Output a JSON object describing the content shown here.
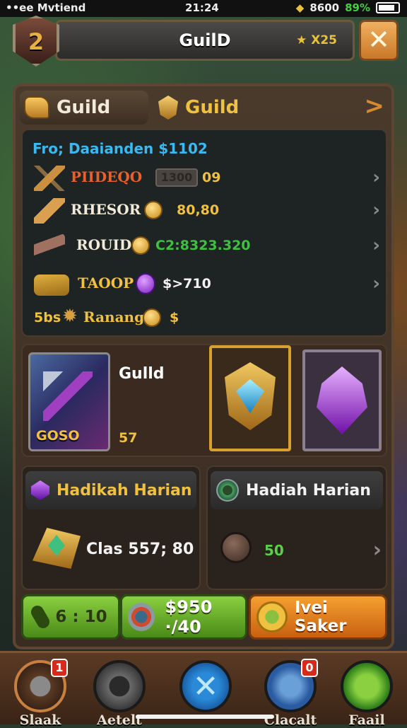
{
  "status_bar": {
    "carrier": "••ee Mvtiend",
    "time": "21:24",
    "coins": "8600",
    "battery": "89%"
  },
  "header": {
    "level": "2",
    "title": "GuilD",
    "currency": "X25",
    "close_label": "✕"
  },
  "tabs": [
    {
      "label": "Guild"
    },
    {
      "label": "Guild"
    }
  ],
  "tab_arrow": ">",
  "list": {
    "heading": "Fro; Daaianden $1102",
    "rows": [
      {
        "label": "PIIDEQO",
        "pill": "1300",
        "value": "09",
        "label_color": "#e8602a",
        "value_color": "#f0c040"
      },
      {
        "label": "RHESOR",
        "value": "80,80",
        "label_color": "#f2ead8",
        "value_color": "#f0c040"
      },
      {
        "label": "ROUID",
        "value": "C2:8323.320",
        "label_color": "#f2ead8",
        "value_color": "#40c040"
      },
      {
        "label": "TAOOP",
        "value": "$>710",
        "label_color": "#f0c040",
        "value_color": "#f2f2f2"
      },
      {
        "prefix": "5bs",
        "label": "Ranang",
        "value": "$",
        "label_color": "#f0c040",
        "value_color": "#f0c040"
      }
    ]
  },
  "cards": {
    "card1_value": "GOSO",
    "title": "Gulld",
    "number": "57"
  },
  "rewards": [
    {
      "heading": "Hadikah Harian",
      "text": "Clas 557; 80"
    },
    {
      "heading": "Hadiah Harian",
      "text": "50"
    }
  ],
  "actions": {
    "timer": "6 : 10",
    "price": "$950​·/40",
    "orange_label": "Ivei Saker"
  },
  "nav": [
    {
      "label": "Slaak",
      "badge": "1"
    },
    {
      "label": "Aetelt"
    },
    {
      "label": ""
    },
    {
      "label": "Clacalt",
      "badge": "0"
    },
    {
      "label": "Faail"
    }
  ]
}
